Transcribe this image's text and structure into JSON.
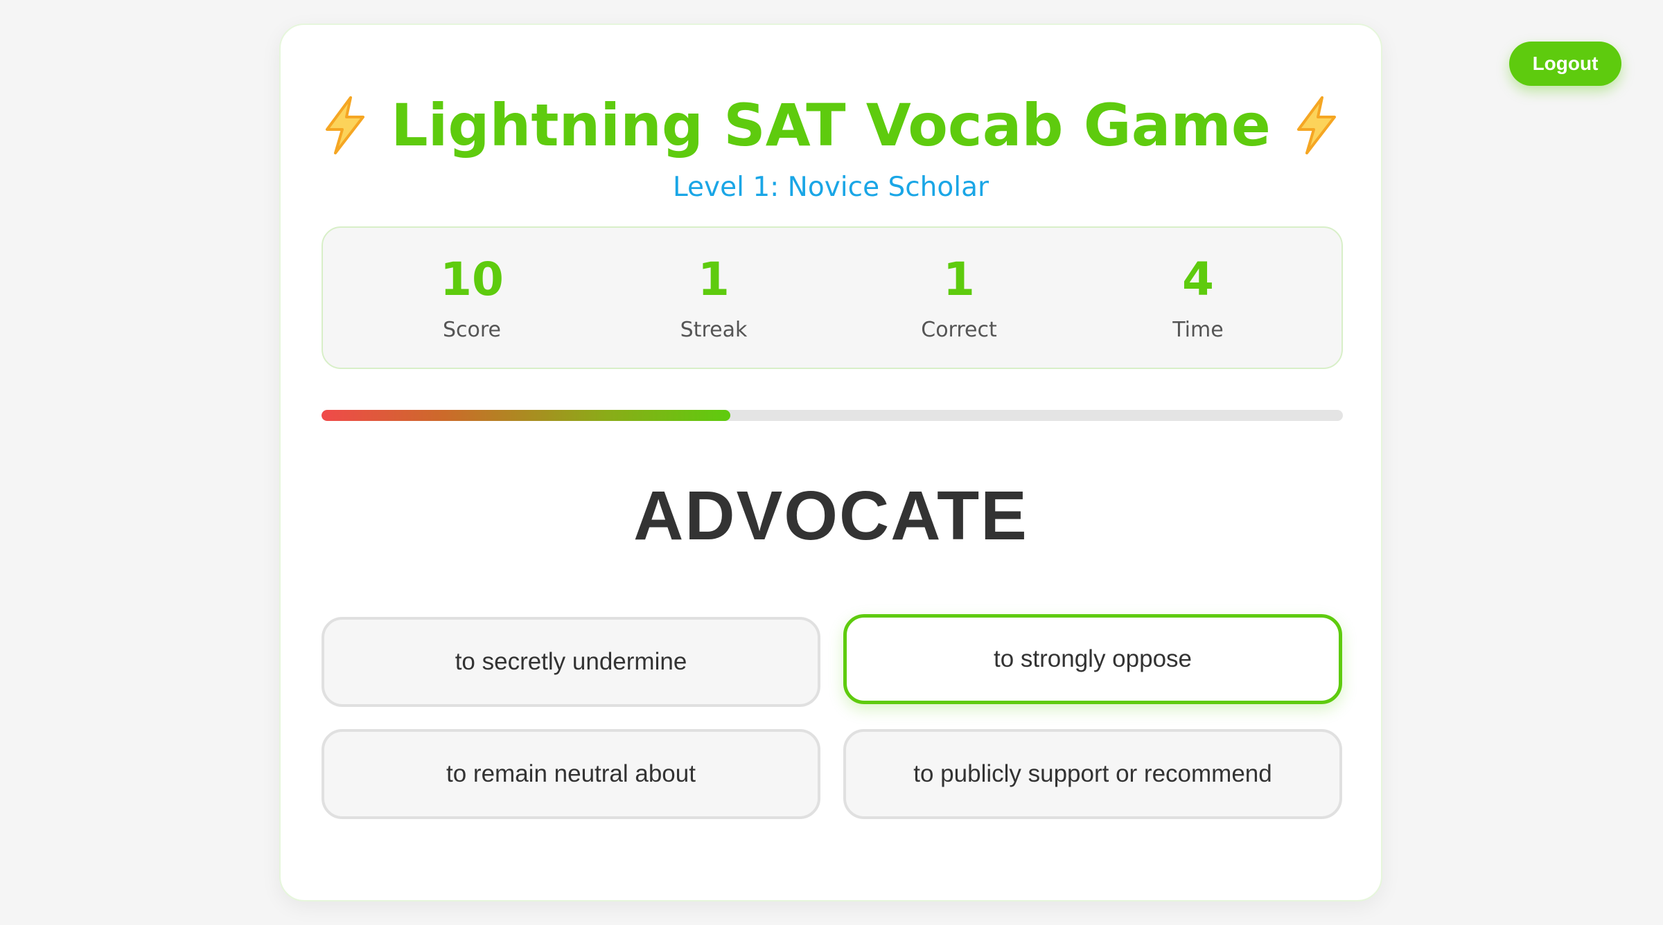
{
  "header": {
    "logout_label": "Logout"
  },
  "game": {
    "title": "Lightning SAT Vocab Game",
    "title_icon": "lightning-bolt-icon",
    "level": "Level 1: Novice Scholar",
    "stats": [
      {
        "value": "10",
        "label": "Score"
      },
      {
        "value": "1",
        "label": "Streak"
      },
      {
        "value": "1",
        "label": "Correct"
      },
      {
        "value": "4",
        "label": "Time"
      }
    ],
    "timer_progress_fraction": 0.4,
    "word": "ADVOCATE",
    "options": [
      {
        "label": "to secretly undermine",
        "selected": false
      },
      {
        "label": "to strongly oppose",
        "selected": true
      },
      {
        "label": "to remain neutral about",
        "selected": false
      },
      {
        "label": "to publicly support or recommend",
        "selected": false
      }
    ]
  },
  "colors": {
    "accent": "#5ecb0e",
    "level_text": "#1aa6e6",
    "bolt": "#f5a623",
    "progress_start": "#f04a4a"
  }
}
